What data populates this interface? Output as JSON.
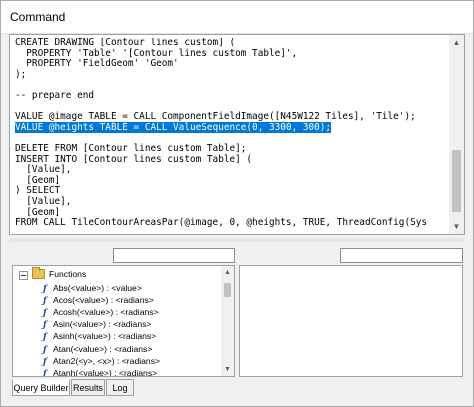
{
  "window": {
    "title": "Command"
  },
  "editor": {
    "lines": [
      "CREATE DRAWING [Contour lines custom] (",
      "  PROPERTY 'Table' '[Contour lines custom Table]',",
      "  PROPERTY 'FieldGeom' 'Geom'",
      ");",
      "",
      "-- prepare end",
      "",
      "VALUE @image TABLE = CALL ComponentFieldImage([N45W122 Tiles], 'Tile');",
      "VALUE @heights TABLE = CALL ValueSequence(0, 3300, 300);",
      "",
      "DELETE FROM [Contour lines custom Table];",
      "INSERT INTO [Contour lines custom Table] (",
      "  [Value],",
      "  [Geom]",
      ") SELECT",
      "  [Value],",
      "  [Geom]",
      "FROM CALL TileContourAreasPar(@image, 0, @heights, TRUE, ThreadConfig(Sys"
    ],
    "selected_line_index": 8
  },
  "query_builder": {
    "functions_group": "Functions",
    "functions": [
      "Abs(<value>) : <value>",
      "Acos(<value>) : <radians>",
      "Acosh(<value>) : <radians>",
      "Asin(<value>) : <radians>",
      "Asinh(<value>) : <radians>",
      "Atan(<value>) : <radians>",
      "Atan2(<y>, <x>) : <radians>",
      "Atanh(<value>) : <radians>"
    ]
  },
  "tabs": [
    {
      "label": "Query Builder",
      "active": true
    },
    {
      "label": "Results",
      "active": false
    },
    {
      "label": "Log",
      "active": false
    }
  ]
}
